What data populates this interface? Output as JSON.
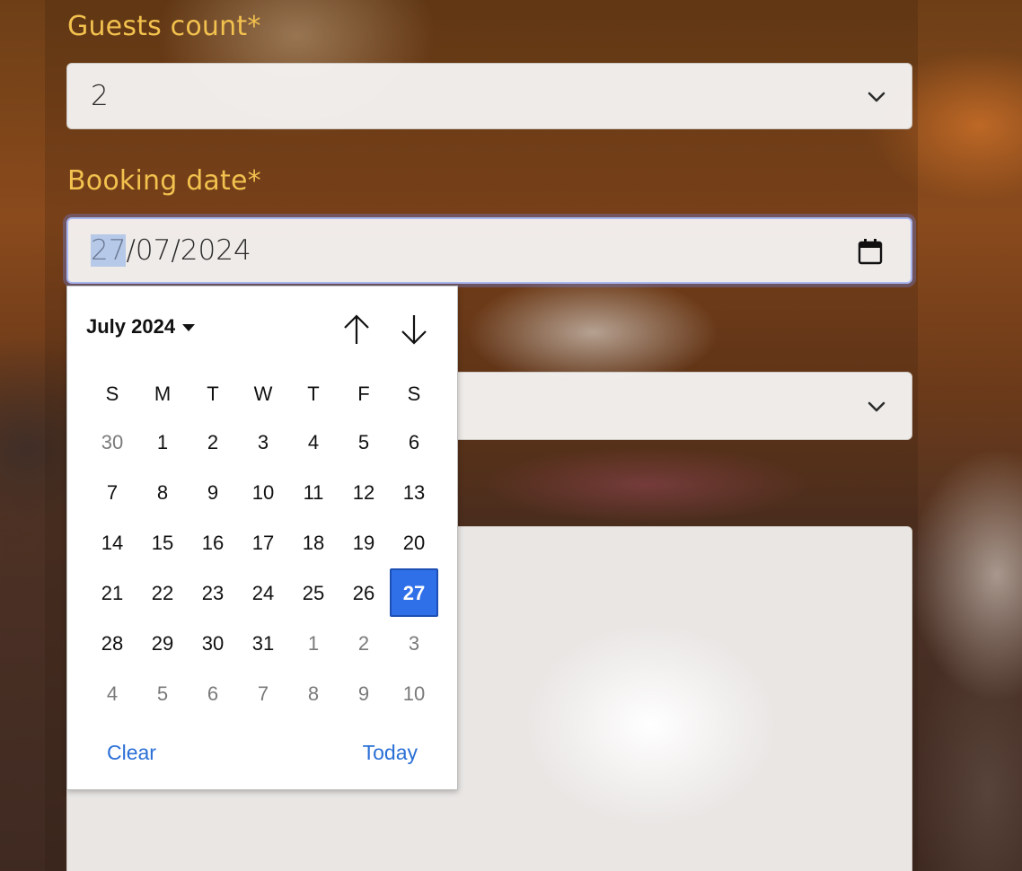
{
  "guests": {
    "label": "Guests count*",
    "value": "2"
  },
  "booking_date": {
    "label": "Booking date*",
    "day_segment": "27",
    "rest_value": "/07/2024"
  },
  "calendar": {
    "month_label": "July 2024",
    "weekdays": [
      "S",
      "M",
      "T",
      "W",
      "T",
      "F",
      "S"
    ],
    "weeks": [
      [
        {
          "d": "30",
          "m": true
        },
        {
          "d": "1"
        },
        {
          "d": "2"
        },
        {
          "d": "3"
        },
        {
          "d": "4"
        },
        {
          "d": "5"
        },
        {
          "d": "6"
        }
      ],
      [
        {
          "d": "7"
        },
        {
          "d": "8"
        },
        {
          "d": "9"
        },
        {
          "d": "10"
        },
        {
          "d": "11"
        },
        {
          "d": "12"
        },
        {
          "d": "13"
        }
      ],
      [
        {
          "d": "14"
        },
        {
          "d": "15"
        },
        {
          "d": "16"
        },
        {
          "d": "17"
        },
        {
          "d": "18"
        },
        {
          "d": "19"
        },
        {
          "d": "20"
        }
      ],
      [
        {
          "d": "21"
        },
        {
          "d": "22"
        },
        {
          "d": "23"
        },
        {
          "d": "24"
        },
        {
          "d": "25"
        },
        {
          "d": "26"
        },
        {
          "d": "27",
          "s": true
        }
      ],
      [
        {
          "d": "28"
        },
        {
          "d": "29"
        },
        {
          "d": "30"
        },
        {
          "d": "31"
        },
        {
          "d": "1",
          "m": true
        },
        {
          "d": "2",
          "m": true
        },
        {
          "d": "3",
          "m": true
        }
      ],
      [
        {
          "d": "4",
          "m": true
        },
        {
          "d": "5",
          "m": true
        },
        {
          "d": "6",
          "m": true
        },
        {
          "d": "7",
          "m": true
        },
        {
          "d": "8",
          "m": true
        },
        {
          "d": "9",
          "m": true
        },
        {
          "d": "10",
          "m": true
        }
      ]
    ],
    "clear_label": "Clear",
    "today_label": "Today",
    "selected_color": "#2f6fe8",
    "link_color": "#2a6fd6"
  },
  "icons": {
    "guests_dropdown": "chevron-down-icon",
    "date_picker": "calendar-icon",
    "prev_month": "arrow-up-icon",
    "next_month": "arrow-down-icon",
    "third_dropdown": "chevron-down-icon"
  },
  "colors": {
    "label": "#f2c14e",
    "focus_ring": "#aab8f2"
  }
}
